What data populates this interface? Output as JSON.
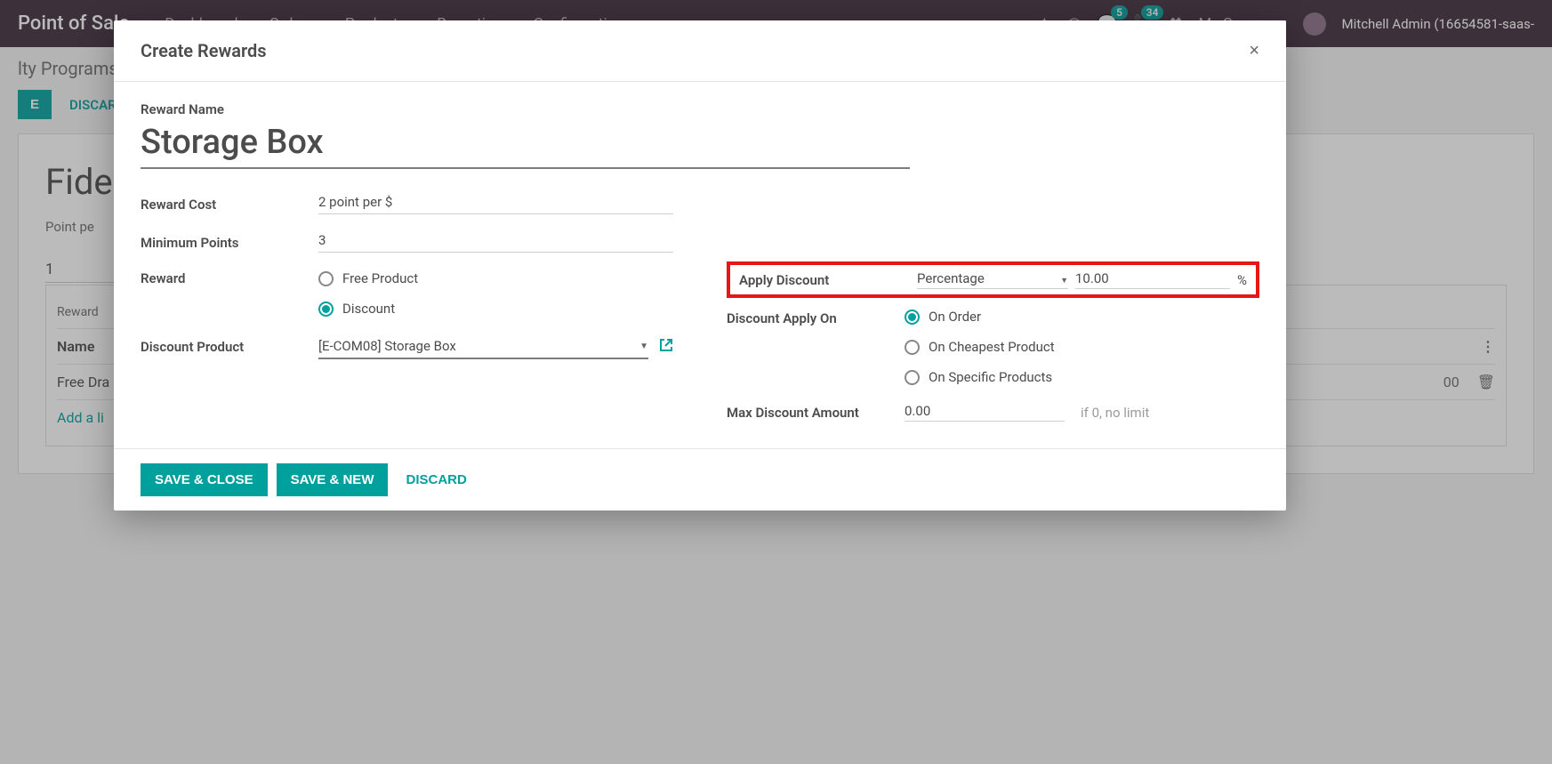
{
  "topnav": {
    "brand": "Point of Sale",
    "items": [
      "Dashboard",
      "Orders",
      "Products",
      "Reporting",
      "Configuration"
    ],
    "badge1": "5",
    "badge2": "34",
    "company": "My Company",
    "user": "Mitchell Admin (16654581-saas-"
  },
  "subhead": {
    "breadcrumb": "lty Programs"
  },
  "toolbar": {
    "save": "E",
    "discard": "DISCARD"
  },
  "bg": {
    "title": "Fide",
    "pointper_label": "Point pe",
    "pointper_value": "1",
    "tab": "Rewa",
    "reward_row": "Reward ",
    "name_header": "Name",
    "row1": "Free Dra",
    "addline": "Add a li",
    "row_amount": "00"
  },
  "modal": {
    "title": "Create Rewards",
    "reward_name_label": "Reward Name",
    "reward_name": "Storage Box",
    "reward_cost_label": "Reward Cost",
    "reward_cost_value": "2 point per $",
    "min_points_label": "Minimum Points",
    "min_points_value": "3",
    "reward_label": "Reward",
    "reward_options": {
      "free_product": "Free Product",
      "discount": "Discount"
    },
    "reward_selected": "discount",
    "discount_product_label": "Discount Product",
    "discount_product_value": "[E-COM08] Storage Box",
    "apply_discount_label": "Apply Discount",
    "apply_discount_type": "Percentage",
    "apply_discount_value": "10.00",
    "apply_discount_unit": "%",
    "discount_apply_on_label": "Discount Apply On",
    "discount_apply_options": {
      "on_order": "On Order",
      "on_cheapest": "On Cheapest Product",
      "on_specific": "On Specific Products"
    },
    "discount_apply_selected": "on_order",
    "max_discount_label": "Max Discount Amount",
    "max_discount_value": "0.00",
    "max_discount_hint": "if 0, no limit",
    "footer": {
      "save_close": "SAVE & CLOSE",
      "save_new": "SAVE & NEW",
      "discard": "DISCARD"
    }
  },
  "colors": {
    "primary": "#00a09d",
    "highlight_border": "#e61717"
  }
}
